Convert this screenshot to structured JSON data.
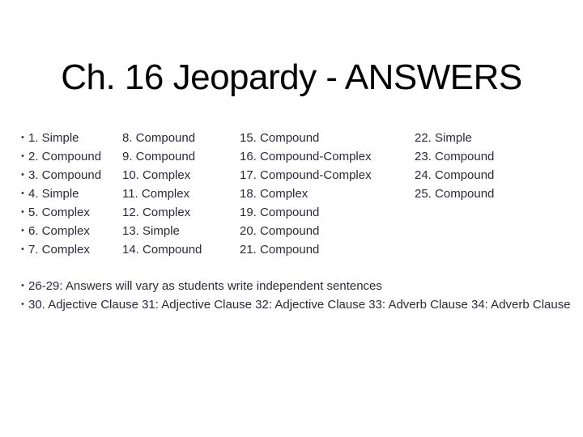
{
  "title": "Ch. 16 Jeopardy - ANSWERS",
  "bullet_glyph": "•",
  "columns": [
    [
      "1. Simple",
      "2. Compound",
      "3. Compound",
      "4. Simple",
      "5. Complex",
      "6. Complex",
      "7. Complex"
    ],
    [
      "8. Compound",
      "9. Compound",
      "10. Complex",
      "11. Complex",
      "12. Complex",
      "13. Simple",
      "14. Compound"
    ],
    [
      "15. Compound",
      "16. Compound-Complex",
      "17. Compound-Complex",
      "18. Complex",
      "19. Compound",
      "20. Compound",
      "21. Compound"
    ],
    [
      "22. Simple",
      "23. Compound",
      "24. Compound",
      "25. Compound"
    ]
  ],
  "notes": [
    "26-29: Answers will vary as students write independent sentences",
    "30. Adjective Clause 31: Adjective Clause 32: Adjective Clause  33: Adverb Clause  34: Adverb Clause"
  ]
}
